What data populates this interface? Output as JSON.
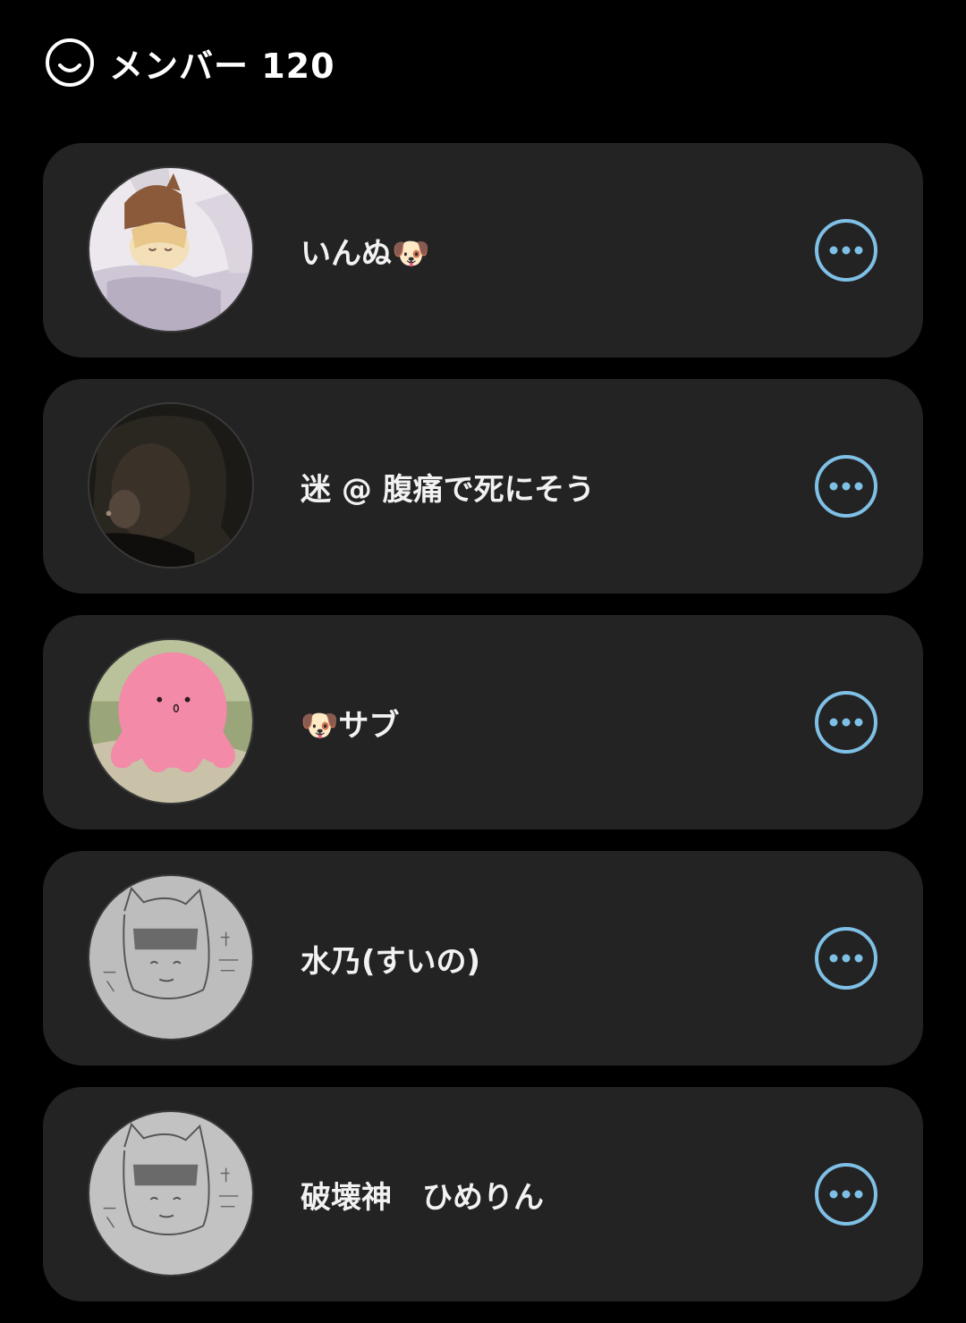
{
  "header": {
    "icon": "smile-icon",
    "title": "メンバー 120"
  },
  "colors": {
    "background": "#000000",
    "card": "#232323",
    "accent": "#7fc0e6",
    "text": "#f2f2f2"
  },
  "members": [
    {
      "name": "いんぬ🐶",
      "avatar": "avatar-illustration-cat-hat",
      "more_icon": "more-options-icon"
    },
    {
      "name": "迷 @ 腹痛で死にそう",
      "avatar": "avatar-dark-photo",
      "more_icon": "more-options-icon"
    },
    {
      "name": "🐶サブ",
      "avatar": "avatar-pink-octopus",
      "more_icon": "more-options-icon"
    },
    {
      "name": "水乃(すいの)",
      "avatar": "avatar-pencil-sketch",
      "more_icon": "more-options-icon"
    },
    {
      "name": "破壊神　ひめりん",
      "avatar": "avatar-pencil-sketch",
      "more_icon": "more-options-icon"
    }
  ]
}
